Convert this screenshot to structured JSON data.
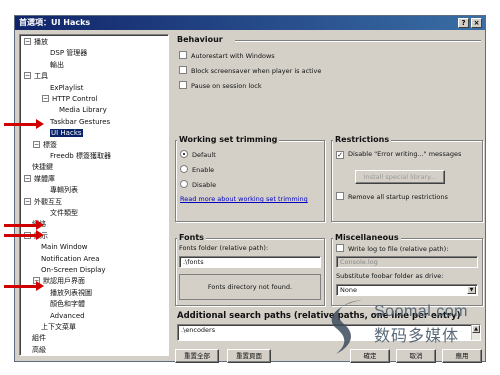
{
  "window": {
    "title": "首選項：UI Hacks",
    "help_btn": "?",
    "close_btn": "×"
  },
  "tree": [
    {
      "label": "播放",
      "exp": "−"
    },
    {
      "label": "DSP 管理器"
    },
    {
      "label": "輸出"
    },
    {
      "label": "工具",
      "exp": "−"
    },
    {
      "label": "ExPlaylist"
    },
    {
      "label": "HTTP Control",
      "exp": "−"
    },
    {
      "label": "Media Library"
    },
    {
      "label": "Taskbar Gestures"
    },
    {
      "label": "UI Hacks",
      "selected": true
    },
    {
      "label": "標簽",
      "exp": "−"
    },
    {
      "label": "Freedb 標簽獲取器"
    },
    {
      "label": "快捷鍵"
    },
    {
      "label": "媒體庫",
      "exp": "−"
    },
    {
      "label": "專輯列表"
    },
    {
      "label": "外觀互互",
      "exp": "−"
    },
    {
      "label": "文件類型"
    },
    {
      "label": "網絡"
    },
    {
      "label": "顯示",
      "exp": "−"
    },
    {
      "label": "Main Window"
    },
    {
      "label": "Notification Area"
    },
    {
      "label": "On-Screen Display"
    },
    {
      "label": "默認用戶界面",
      "exp": "−"
    },
    {
      "label": "播放列表視圖"
    },
    {
      "label": "顏色和字體"
    },
    {
      "label": "Advanced"
    },
    {
      "label": "上下文菜單"
    },
    {
      "label": "組件"
    },
    {
      "label": "高級"
    }
  ],
  "behaviour": {
    "title": "Behaviour",
    "checks": [
      {
        "label": "Autorestart with Windows",
        "checked": false
      },
      {
        "label": "Block screensaver when player is active",
        "checked": false
      },
      {
        "label": "Pause on session lock",
        "checked": false
      }
    ]
  },
  "working_set": {
    "title": "Working set trimming",
    "options": [
      {
        "label": "Default",
        "on": true
      },
      {
        "label": "Enable",
        "on": false
      },
      {
        "label": "Disable",
        "on": false
      }
    ],
    "link": "Read more about working set trimming"
  },
  "restrictions": {
    "title": "Restrictions",
    "disable_error": "Disable \"Error writing...\" messages",
    "disable_error_checked": true,
    "install_btn": "Install special library...",
    "remove_startup": "Remove all startup restrictions"
  },
  "fonts": {
    "title": "Fonts",
    "folder_label": "Fonts folder (relative path):",
    "folder_value": ".\\fonts",
    "status": "Fonts directory not found."
  },
  "misc": {
    "title": "Miscellaneous",
    "write_log": "Write log to file (relative path):",
    "log_value": "Console.log",
    "substitute_label": "Substitute foobar folder as drive:",
    "drive_value": "None"
  },
  "search_paths": {
    "title": "Additional search paths (relative paths, one line per entry)",
    "value": ".\\encoders"
  },
  "buttons": {
    "reset_all": "重置全部",
    "reset_page": "重置頁面",
    "ok": "確定",
    "cancel": "取消",
    "apply": "應用"
  },
  "watermark": {
    "line1": "Soomal.com",
    "line2": "数码多媒体"
  },
  "colors": {
    "titlebar": "#10246a",
    "arrow": "#d00000",
    "selection": "#0a246a"
  }
}
